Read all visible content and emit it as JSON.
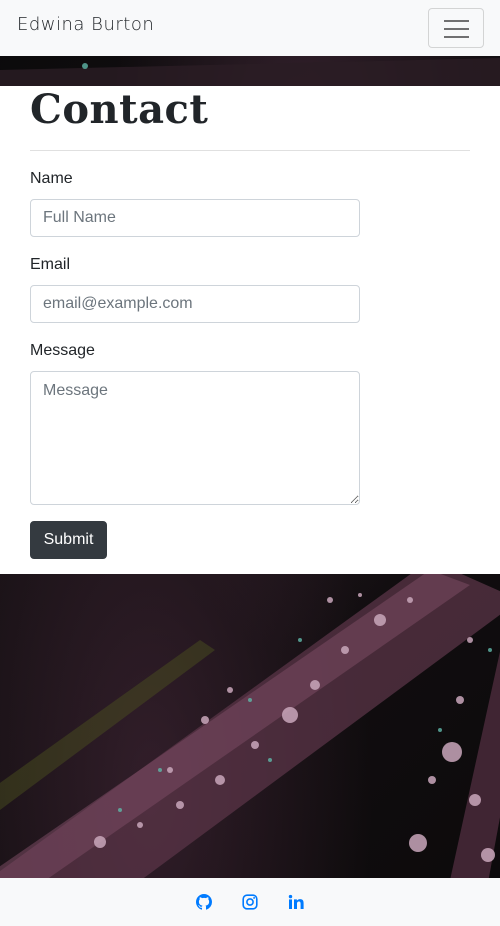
{
  "navbar": {
    "brand": "Edwina Burton",
    "toggler_icon": "hamburger-menu-icon"
  },
  "contact": {
    "title": "Contact",
    "name": {
      "label": "Name",
      "placeholder": "Full Name",
      "value": ""
    },
    "email": {
      "label": "Email",
      "placeholder": "email@example.com",
      "value": ""
    },
    "message": {
      "label": "Message",
      "placeholder": "Message",
      "value": ""
    },
    "submit_label": "Submit"
  },
  "footer": {
    "links": [
      {
        "icon": "github-icon",
        "color": "#007bff"
      },
      {
        "icon": "instagram-icon",
        "color": "#007bff"
      },
      {
        "icon": "linkedin-icon",
        "color": "#007bff"
      }
    ]
  },
  "colors": {
    "navbar_bg": "#f8f9fa",
    "button_dark": "#343a40",
    "link_blue": "#007bff"
  }
}
